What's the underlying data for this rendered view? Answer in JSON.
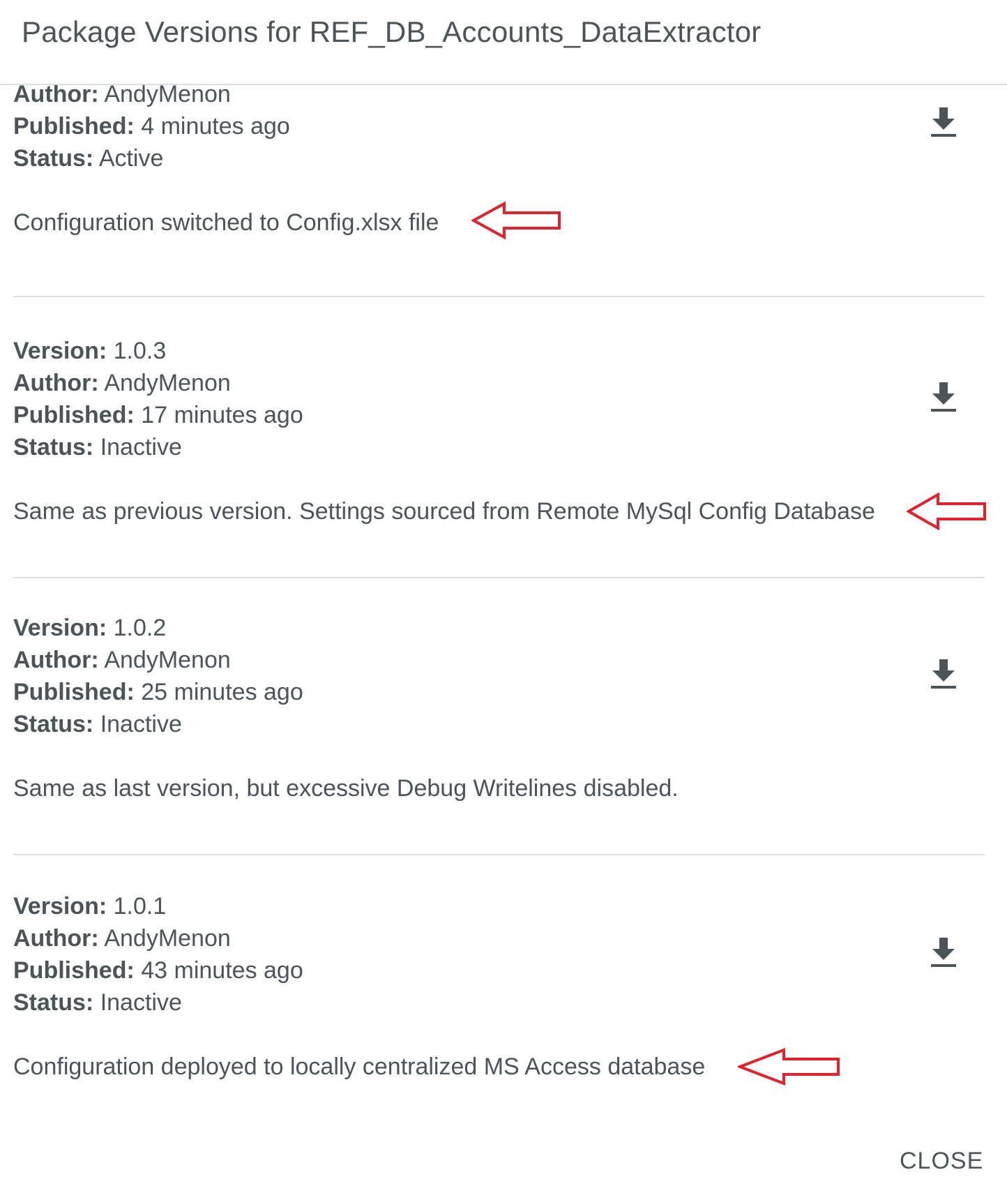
{
  "dialog": {
    "title": "Package Versions for REF_DB_Accounts_DataExtractor",
    "close_label": "CLOSE"
  },
  "labels": {
    "version": "Version:",
    "author": "Author:",
    "published": "Published:",
    "status": "Status:"
  },
  "versions": [
    {
      "version": "",
      "author": "AndyMenon",
      "published": "4 minutes ago",
      "status": "Active",
      "description": "Configuration switched to Config.xlsx file",
      "annotated": true
    },
    {
      "version": "1.0.3",
      "author": "AndyMenon",
      "published": "17 minutes ago",
      "status": "Inactive",
      "description": "Same as previous version. Settings sourced from Remote MySql Config Database",
      "annotated": true
    },
    {
      "version": "1.0.2",
      "author": "AndyMenon",
      "published": "25 minutes ago",
      "status": "Inactive",
      "description": "Same as last version, but excessive Debug Writelines disabled.",
      "annotated": false
    },
    {
      "version": "1.0.1",
      "author": "AndyMenon",
      "published": "43 minutes ago",
      "status": "Inactive",
      "description": "Configuration deployed to locally centralized MS Access database",
      "annotated": true
    }
  ],
  "icons": {
    "download": "download-icon",
    "annotation": "red-arrow-annotation"
  },
  "colors": {
    "text": "#4a5459",
    "divider": "#dcdfe1",
    "annotation": "#e3202c"
  }
}
